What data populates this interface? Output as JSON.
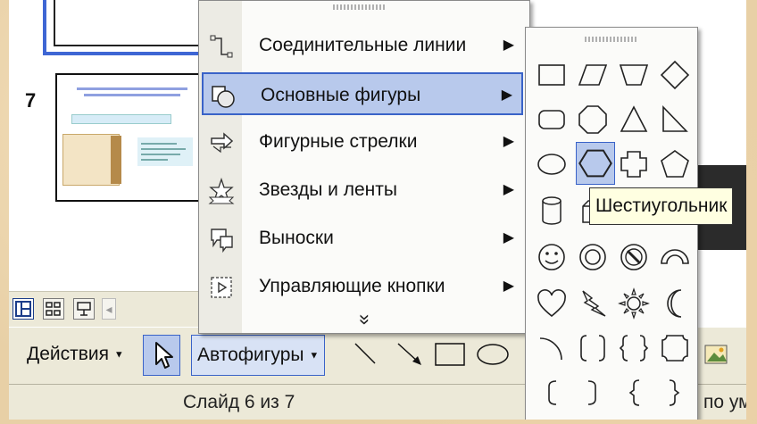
{
  "slides": {
    "current_number": "7"
  },
  "menu": {
    "items": [
      {
        "label": "Соединительные линии",
        "icon": "connector-lines-icon"
      },
      {
        "label": "Основные фигуры",
        "icon": "basic-shapes-icon"
      },
      {
        "label": "Фигурные стрелки",
        "icon": "block-arrows-icon"
      },
      {
        "label": "Звезды и ленты",
        "icon": "stars-banners-icon"
      },
      {
        "label": "Выноски",
        "icon": "callouts-icon"
      },
      {
        "label": "Управляющие кнопки",
        "icon": "action-buttons-icon"
      }
    ],
    "selected_index": 1,
    "expand": "»"
  },
  "submenu": {
    "highlighted": "hexagon",
    "tooltip": "Шестиугольник"
  },
  "toolbar": {
    "actions_label": "Действия",
    "autoshapes_label": "Автофигуры"
  },
  "status": {
    "slide_text": "Слайд 6 из 7",
    "right_text": "по умо"
  },
  "colors": {
    "highlight": "#b8c9ec",
    "highlight_border": "#3a63c8",
    "slide_selected_border": "#3e66d4"
  }
}
